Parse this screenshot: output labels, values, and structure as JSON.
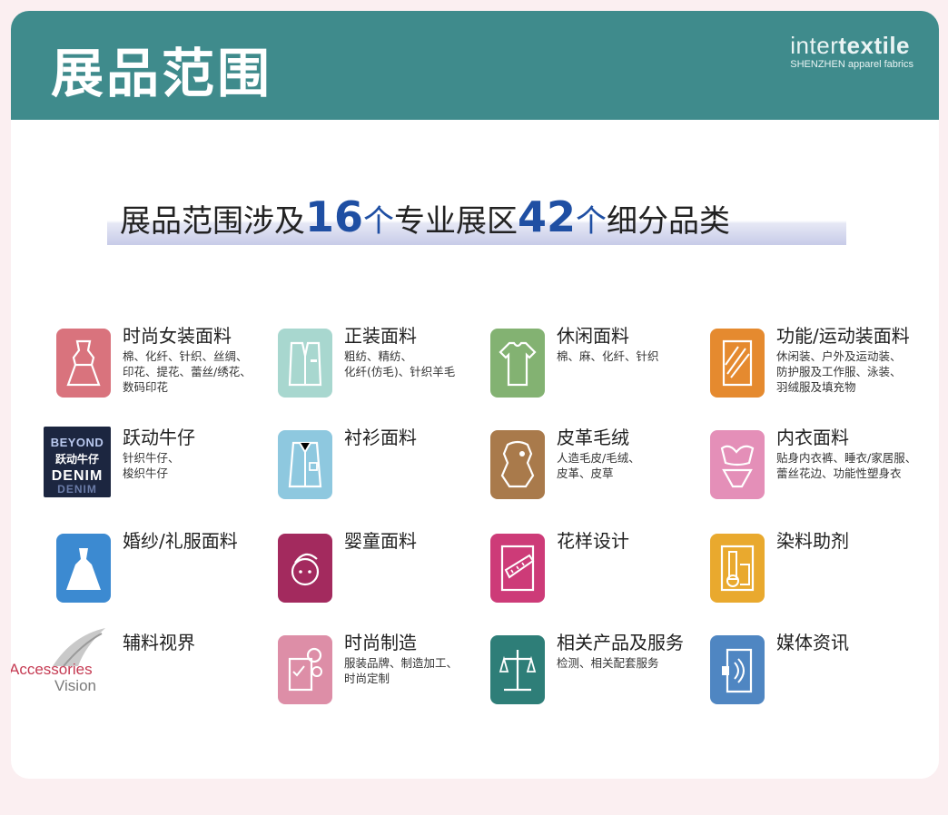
{
  "header": {
    "title": "展品范围",
    "brand_inter": "inter",
    "brand_textile": "textile",
    "brand_sub": "SHENZHEN apparel fabrics"
  },
  "headline": {
    "part1": "展品范围涉及",
    "num1": "16",
    "ge1": "个",
    "part2": "专业展区",
    "num2": "42",
    "ge2": "个",
    "part3": "细分品类"
  },
  "categories": [
    {
      "title": "时尚女装面料",
      "icon": "dress-icon",
      "color": "#d9737d",
      "desc": [
        "棉、化纤、针织、丝绸、",
        "印花、提花、蕾丝/绣花、",
        "数码印花"
      ]
    },
    {
      "title": "正装面料",
      "icon": "suit-icon",
      "color": "#a8d7cf",
      "desc": [
        "粗纺、精纺、",
        "化纤(仿毛)、针织羊毛"
      ]
    },
    {
      "title": "休闲面料",
      "icon": "tshirt-icon",
      "color": "#83b272",
      "desc": [
        "棉、麻、化纤、针织"
      ]
    },
    {
      "title": "功能/运动装面料",
      "icon": "sportswear-icon",
      "color": "#e58a2f",
      "desc": [
        "休闲装、户外及运动装、",
        "防护服及工作服、泳装、",
        "羽绒服及填充物"
      ]
    },
    {
      "title": "跃动牛仔",
      "icon": "denim-logo",
      "color": "#1c2640",
      "desc": [
        "针织牛仔、",
        "梭织牛仔"
      ]
    },
    {
      "title": "衬衫面料",
      "icon": "shirt-icon",
      "color": "#8ec8df",
      "desc": []
    },
    {
      "title": "皮革毛绒",
      "icon": "leather-icon",
      "color": "#a97a4b",
      "desc": [
        "人造毛皮/毛绒、",
        "皮革、皮草"
      ]
    },
    {
      "title": "内衣面料",
      "icon": "lingerie-icon",
      "color": "#e48fb8",
      "desc": [
        "贴身内衣裤、睡衣/家居服、",
        "蕾丝花边、功能性塑身衣"
      ]
    },
    {
      "title": "婚纱/礼服面料",
      "icon": "wedding-dress-icon",
      "color": "#3c8ad1",
      "desc": []
    },
    {
      "title": "婴童面料",
      "icon": "baby-icon",
      "color": "#a32a5e",
      "desc": []
    },
    {
      "title": "花样设计",
      "icon": "design-ruler-icon",
      "color": "#cd3b78",
      "desc": []
    },
    {
      "title": "染料助剂",
      "icon": "dye-icon",
      "color": "#e9a92e",
      "desc": []
    },
    {
      "title": "辅料视界",
      "icon": "accessories-logo",
      "color": "#c53a52",
      "desc": []
    },
    {
      "title": "时尚制造",
      "icon": "manufacturing-icon",
      "color": "#dd8ea7",
      "desc": [
        "服装品牌、制造加工、",
        "时尚定制"
      ]
    },
    {
      "title": "相关产品及服务",
      "icon": "scale-icon",
      "color": "#2e7e78",
      "desc": [
        "检测、相关配套服务"
      ]
    },
    {
      "title": "媒体资讯",
      "icon": "media-icon",
      "color": "#4f86c2",
      "desc": []
    }
  ],
  "denim_logo": {
    "line1": "BEYOND",
    "line2": "跃动牛仔",
    "line3": "DENIM",
    "line4": "DENIM"
  },
  "accessories_logo": {
    "line1": "Accessories",
    "line2": "Vision"
  }
}
